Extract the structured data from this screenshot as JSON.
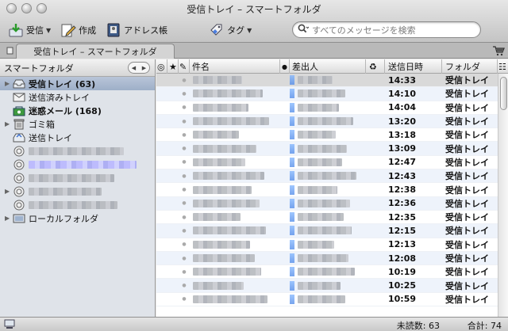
{
  "window": {
    "title": "受信トレイ – スマートフォルダ"
  },
  "toolbar": {
    "receive_label": "受信",
    "compose_label": "作成",
    "address_book_label": "アドレス帳",
    "tag_label": "タグ",
    "search_placeholder": "すべてのメッセージを検索"
  },
  "tab": {
    "label": "受信トレイ – スマートフォルダ"
  },
  "sidebar": {
    "header": "スマートフォルダ",
    "items": [
      {
        "label": "受信トレイ (63)",
        "icon": "inbox-icon",
        "selected": true
      },
      {
        "label": "送信済みトレイ",
        "icon": "sent-icon"
      },
      {
        "label": "迷惑メール (168)",
        "icon": "junk-icon",
        "bold": true
      },
      {
        "label": "ゴミ箱",
        "icon": "trash-icon"
      },
      {
        "label": "送信トレイ",
        "icon": "outbox-icon"
      },
      {
        "label": "ローカルフォルダ",
        "icon": "local-folders-icon"
      }
    ]
  },
  "columns": {
    "subject": "件名",
    "from": "差出人",
    "date": "送信日時",
    "folder": "フォルダ"
  },
  "messages": [
    {
      "time": "14:33",
      "folder": "受信トレイ"
    },
    {
      "time": "14:10",
      "folder": "受信トレイ"
    },
    {
      "time": "14:04",
      "folder": "受信トレイ"
    },
    {
      "time": "13:20",
      "folder": "受信トレイ"
    },
    {
      "time": "13:18",
      "folder": "受信トレイ"
    },
    {
      "time": "13:09",
      "folder": "受信トレイ"
    },
    {
      "time": "12:47",
      "folder": "受信トレイ"
    },
    {
      "time": "12:43",
      "folder": "受信トレイ"
    },
    {
      "time": "12:38",
      "folder": "受信トレイ"
    },
    {
      "time": "12:36",
      "folder": "受信トレイ"
    },
    {
      "time": "12:35",
      "folder": "受信トレイ"
    },
    {
      "time": "12:15",
      "folder": "受信トレイ"
    },
    {
      "time": "12:13",
      "folder": "受信トレイ"
    },
    {
      "time": "12:08",
      "folder": "受信トレイ"
    },
    {
      "time": "10:19",
      "folder": "受信トレイ"
    },
    {
      "time": "10:25",
      "folder": "受信トレイ"
    },
    {
      "time": "10:59",
      "folder": "受信トレイ"
    }
  ],
  "status": {
    "unread": "未読数: 63",
    "total": "合計: 74"
  }
}
